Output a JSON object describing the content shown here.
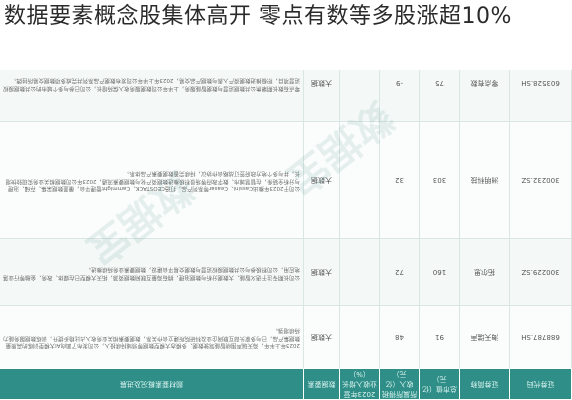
{
  "headline": "数据要素概念股集体高开 零点有数等多股涨超10%",
  "table": {
    "headers": [
      "证券代码",
      "证券简称",
      "总市值（亿元）",
      "所属所得税收入（亿元）",
      "2023年营业收入增长（%）",
      "数据要素",
      "题材要素概况及进展"
    ],
    "rows": [
      {
        "code": "688787.SH",
        "name": "海天瑞声",
        "mcap": "91",
        "revenue": "48",
        "growth": "",
        "tag": "大数据",
        "summary": "2023年上半年，海天瑞声围绕智能驾驶数据、多模态大模型数据等领域持续投入，公司发布了面向AI大模型训练的高质量数据集产品，已与多家头部互联网企业及科研院所建立合作关系，数据要素相关业务收入占比稳步提升，训练数据服务能力持续增强。"
      },
      {
        "code": "300229.SZ",
        "name": "拓尔思",
        "mcap": "160",
        "revenue": "72",
        "growth": "",
        "tag": "大数据",
        "summary": "公司长期专注于语义智能、大数据分析与数据治理，拥有海量互联网数据资源，拓天大模型已在媒体、政务、金融等行业落地应用，公司积极参与公共数据授权运营与数据交易平台建设，数据要素业务持续推进。"
      },
      {
        "code": "300232.SZ",
        "name": "洲明科技",
        "mcap": "303",
        "revenue": "32",
        "growth": "",
        "tag": "大数据",
        "summary": "公司于2023年推出Cassini、Ceasar等系列产品，打造CEOSTACK、Cammight管理平台，覆盖数据采集、存储、治理与分析全链条，在智慧城市、数字政府等场景积极推进数据资产化与数据要素流通，2023年公司数据相关业务实现较快增长，并与多个地方政府签订战略合作协议，持续完善数据要素产品体系。"
      },
      {
        "code": "603528.SH",
        "name": "零点有数",
        "mcap": "75",
        "revenue": "-9",
        "growth": "",
        "tag": "大数据",
        "summary": "零点有数长期聚焦公共数据运营与数据智能服务，上半年公司数据服务收入保持增长，公司已参与多个城市的公共数据授权运营项目，积极推进数据资产入表与数据产品交易，2023年上半年公司发布数据产品系列并完成多项数据交易所挂牌。"
      }
    ]
  },
  "watermark": "数据宝"
}
